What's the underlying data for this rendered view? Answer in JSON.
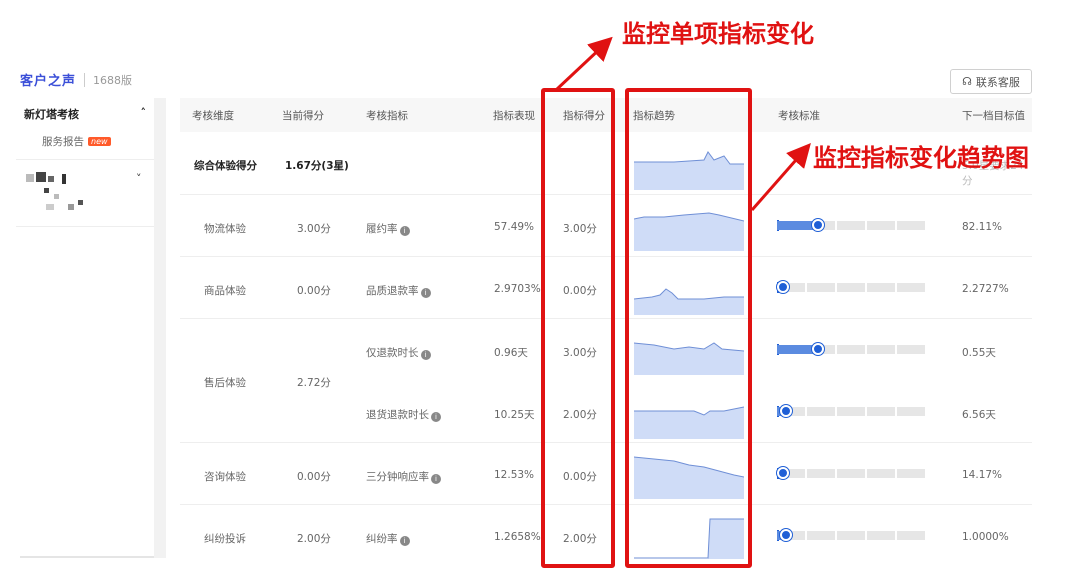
{
  "header": {
    "logo_text": "客户之声",
    "version": "1688版",
    "contact_label": "联系客服"
  },
  "sidebar": {
    "group_title": "新灯塔考核",
    "items": [
      {
        "label": "服务报告",
        "badge": "new"
      }
    ]
  },
  "table": {
    "columns": [
      "考核维度",
      "当前得分",
      "考核指标",
      "指标表现",
      "指标得分",
      "指标趋势",
      "考核标准",
      "下一档目标值"
    ],
    "summary": {
      "label": "综合体验得分",
      "score": "1.67分(3星)",
      "next": "5.0星要求24分"
    },
    "rows": [
      {
        "dimension": "物流体验",
        "score": "3.00分",
        "metric": "履约率",
        "value": "57.49%",
        "metric_score": "3.00分",
        "target": "82.11%",
        "progress": 0.28
      },
      {
        "dimension": "商品体验",
        "score": "0.00分",
        "metric": "品质退款率",
        "value": "2.9703%",
        "metric_score": "0.00分",
        "target": "2.2727%",
        "progress": 0.0
      },
      {
        "dimension": "售后体验",
        "score": "2.72分",
        "metric": "仅退款时长",
        "value": "0.96天",
        "metric_score": "3.00分",
        "target": "0.55天",
        "progress": 0.28
      },
      {
        "dimension": "",
        "score": "",
        "metric": "退货退款时长",
        "value": "10.25天",
        "metric_score": "2.00分",
        "target": "6.56天",
        "progress": 0.06
      },
      {
        "dimension": "咨询体验",
        "score": "0.00分",
        "metric": "三分钟响应率",
        "value": "12.53%",
        "metric_score": "0.00分",
        "target": "14.17%",
        "progress": 0.0
      },
      {
        "dimension": "纠纷投诉",
        "score": "2.00分",
        "metric": "纠纷率",
        "value": "1.2658%",
        "metric_score": "2.00分",
        "target": "1.0000%",
        "progress": 0.06
      }
    ]
  },
  "annotations": {
    "top": "监控单项指标变化",
    "right": "监控指标变化趋势图"
  },
  "colors": {
    "accent": "#e01212",
    "bar_fill": "#5b8be0",
    "spark_fill": "#cfdcf7",
    "spark_line": "#6f8fd6"
  }
}
